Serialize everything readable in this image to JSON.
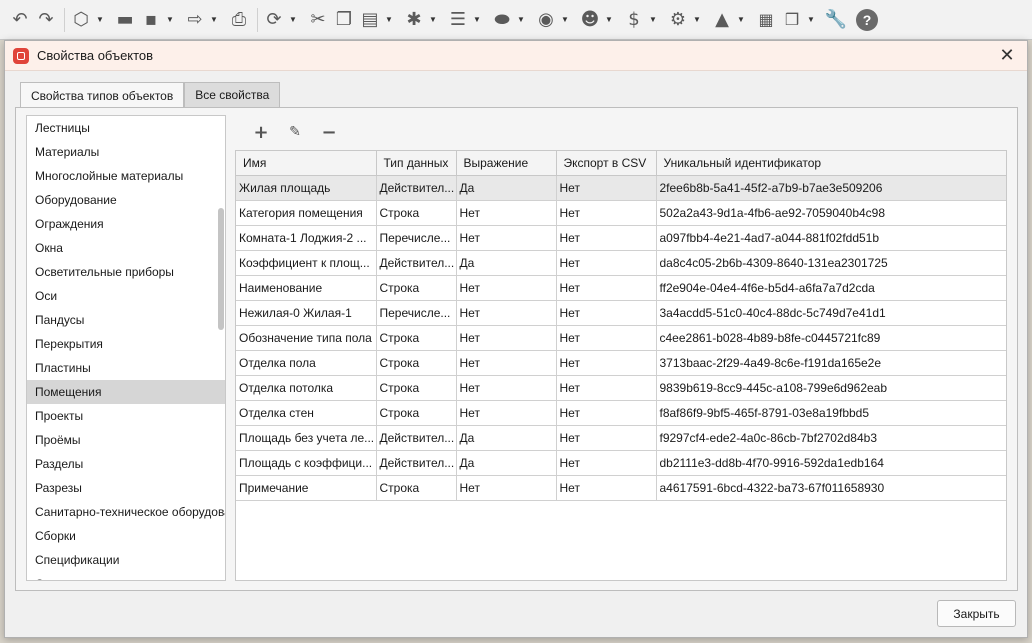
{
  "dialog": {
    "title": "Свойства объектов",
    "close_label": "Закрыть"
  },
  "tabs": [
    {
      "label": "Свойства типов объектов",
      "active": true
    },
    {
      "label": "Все свойства",
      "active": false
    }
  ],
  "type_list": [
    "Лестницы",
    "Материалы",
    "Многослойные материалы",
    "Оборудование",
    "Ограждения",
    "Окна",
    "Осветительные приборы",
    "Оси",
    "Пандусы",
    "Перекрытия",
    "Пластины",
    "Помещения",
    "Проекты",
    "Проёмы",
    "Разделы",
    "Разрезы",
    "Санитарно-техническое оборудование",
    "Сборки",
    "Спецификации",
    "С"
  ],
  "selected_type": "Помещения",
  "columns": [
    "Имя",
    "Тип данных",
    "Выражение",
    "Экспорт в CSV",
    "Уникальный идентификатор"
  ],
  "rows": [
    [
      "Жилая площадь",
      "Действител...",
      "Да",
      "Нет",
      "2fee6b8b-5a41-45f2-a7b9-b7ae3e509206"
    ],
    [
      "Категория помещения",
      "Строка",
      "Нет",
      "Нет",
      "502a2a43-9d1a-4fb6-ae92-7059040b4c98"
    ],
    [
      "Комната-1 Лоджия-2 ...",
      "Перечисле...",
      "Нет",
      "Нет",
      "a097fbb4-4e21-4ad7-a044-881f02fdd51b"
    ],
    [
      "Коэффициент к площ...",
      "Действител...",
      "Да",
      "Нет",
      "da8c4c05-2b6b-4309-8640-131ea2301725"
    ],
    [
      "Наименование",
      "Строка",
      "Нет",
      "Нет",
      "ff2e904e-04e4-4f6e-b5d4-a6fa7a7d2cda"
    ],
    [
      "Нежилая-0 Жилая-1",
      "Перечисле...",
      "Нет",
      "Нет",
      "3a4acdd5-51c0-40c4-88dc-5c749d7e41d1"
    ],
    [
      "Обозначение типа пола",
      "Строка",
      "Нет",
      "Нет",
      "c4ee2861-b028-4b89-b8fe-c0445721fc89"
    ],
    [
      "Отделка пола",
      "Строка",
      "Нет",
      "Нет",
      "3713baac-2f29-4a49-8c6e-f191da165e2e"
    ],
    [
      "Отделка потолка",
      "Строка",
      "Нет",
      "Нет",
      "9839b619-8cc9-445c-a108-799e6d962eab"
    ],
    [
      "Отделка стен",
      "Строка",
      "Нет",
      "Нет",
      "f8af86f9-9bf5-465f-8791-03e8a19fbbd5"
    ],
    [
      "Площадь без учета ле...",
      "Действител...",
      "Да",
      "Нет",
      "f9297cf4-ede2-4a0c-86cb-7bf2702d84b3"
    ],
    [
      "Площадь с коэффици...",
      "Действител...",
      "Да",
      "Нет",
      "db2111e3-dd8b-4f70-9916-592da1edb164"
    ],
    [
      "Примечание",
      "Строка",
      "Нет",
      "Нет",
      "a4617591-6bcd-4322-ba73-67f011658930"
    ]
  ],
  "selected_row": 0,
  "icons": {
    "toolbar": [
      "undo-icon",
      "redo-icon",
      "3d-view-icon",
      "open-folder-icon",
      "save-icon",
      "export-icon",
      "print-icon",
      "sync-icon",
      "cut-icon",
      "copy-icon",
      "paste-icon",
      "walk-icon",
      "list-icon",
      "layer-icon",
      "visibility-icon",
      "users-icon",
      "currency-icon",
      "settings-icon",
      "logo-icon",
      "panels-icon",
      "windows-icon",
      "wrench-icon",
      "help-icon"
    ],
    "grid_tools": [
      "add-icon",
      "edit-icon",
      "remove-icon"
    ]
  },
  "colors": {
    "title_bar": "#fdf0ea",
    "app_icon": "#e0443a",
    "selection": "#d6d6d6"
  }
}
